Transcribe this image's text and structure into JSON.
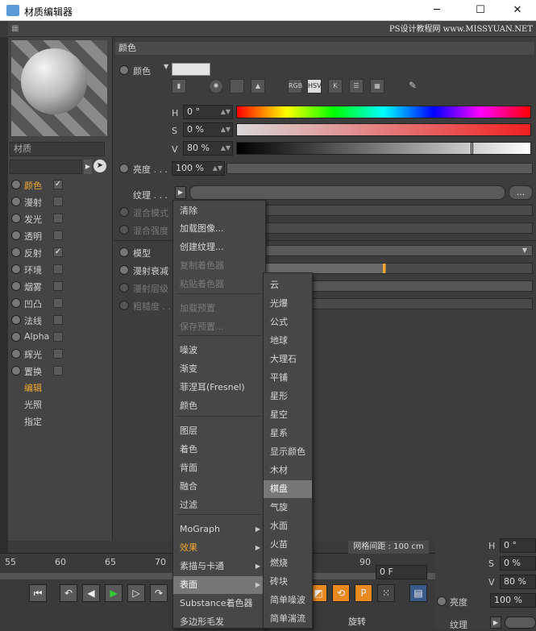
{
  "window": {
    "title": "材质编辑器",
    "minimize": "─",
    "maximize": "☐",
    "close": "✕"
  },
  "watermark": "PS设计教程网 www.MISSYUAN.NET",
  "left": {
    "material_name": "材质",
    "channels": [
      {
        "label": "颜色",
        "checked": true,
        "selected": true
      },
      {
        "label": "漫射",
        "checked": false
      },
      {
        "label": "发光",
        "checked": false
      },
      {
        "label": "透明",
        "checked": false
      },
      {
        "label": "反射",
        "checked": true
      },
      {
        "label": "环境",
        "checked": false
      },
      {
        "label": "烟雾",
        "checked": false
      },
      {
        "label": "凹凸",
        "checked": false
      },
      {
        "label": "法线",
        "checked": false
      },
      {
        "label": "Alpha",
        "checked": false
      },
      {
        "label": "辉光",
        "checked": false
      },
      {
        "label": "置换",
        "checked": false
      }
    ],
    "sub": [
      "编辑",
      "光照",
      "指定"
    ]
  },
  "right": {
    "section": "颜色",
    "color_label": "颜色",
    "modes": [
      "RGB",
      "HSV",
      "K"
    ],
    "h_label": "H",
    "h_value": "0 °",
    "s_label": "S",
    "s_value": "0 %",
    "v_label": "V",
    "v_value": "80 %",
    "brightness_label": "亮度 . . .",
    "brightness_value": "100 %",
    "texture_label": "纹理 . . .",
    "texture_more": "...",
    "blend_mode": "混合模式",
    "blend_strength": "混合强度",
    "model": "模型",
    "diffuse_falloff": "漫射衰减",
    "diffuse_level": "漫射层级",
    "roughness": "粗糙度 . . ."
  },
  "menu1": {
    "items": [
      {
        "label": "清除",
        "dis": false
      },
      {
        "label": "加载图像...",
        "dis": false
      },
      {
        "label": "创建纹理...",
        "dis": false
      },
      {
        "label": "复制着色器",
        "dis": true
      },
      {
        "label": "粘贴着色器",
        "dis": true
      },
      {
        "label": "加载预置",
        "dis": true
      },
      {
        "label": "保存预置...",
        "dis": true
      },
      {
        "label": "噪波",
        "dis": false
      },
      {
        "label": "渐变",
        "dis": false
      },
      {
        "label": "菲涅耳(Fresnel)",
        "dis": false
      },
      {
        "label": "颜色",
        "dis": false
      },
      {
        "label": "图层",
        "dis": false
      },
      {
        "label": "着色",
        "dis": false
      },
      {
        "label": "背面",
        "dis": false
      },
      {
        "label": "融合",
        "dis": false
      },
      {
        "label": "过滤",
        "dis": false
      },
      {
        "label": "MoGraph",
        "dis": false
      },
      {
        "label": "效果",
        "dis": false
      },
      {
        "label": "素描与卡通",
        "dis": false
      },
      {
        "label": "表面",
        "dis": false
      },
      {
        "label": "Substance着色器",
        "dis": false
      },
      {
        "label": "多边形毛发",
        "dis": false
      }
    ]
  },
  "menu2": {
    "items": [
      "云",
      "光爆",
      "公式",
      "地球",
      "大理石",
      "平铺",
      "星形",
      "星空",
      "星系",
      "显示颜色",
      "木材",
      "棋盘",
      "气旋",
      "水面",
      "火苗",
      "燃烧",
      "砖块",
      "简单噪波",
      "简单湍流"
    ]
  },
  "timeline": {
    "ticks": [
      "55",
      "60",
      "65",
      "70",
      "90"
    ],
    "frame": "0 F",
    "grid_spacing": "网格间距 : 100 cm",
    "rotate": "旋转"
  },
  "bottom_right": {
    "h": "H",
    "h_value": "0 °",
    "s": "S",
    "s_value": "0 %",
    "v": "V",
    "v_value": "80 %",
    "brightness": "亮度",
    "brightness_value": "100 %",
    "texture": "纹理"
  }
}
